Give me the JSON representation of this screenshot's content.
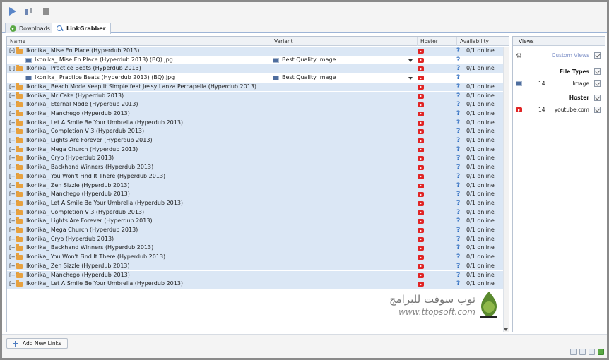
{
  "toolbar": {
    "start_icon": "play-icon",
    "pause_icon": "pause-icon",
    "stop_icon": "stop-icon"
  },
  "tabs": [
    {
      "label": "Downloads",
      "icon": "download-icon"
    },
    {
      "label": "LinkGrabber",
      "icon": "linkgrabber-icon"
    }
  ],
  "table": {
    "columns": {
      "name": "Name",
      "variant": "Variant",
      "hoster": "Hoster",
      "availability": "Availability"
    },
    "rows": [
      {
        "type": "package",
        "expander": "[-]",
        "name": "Ikonika_ Mise En Place (Hyperdub 2013)",
        "availability": "0/1 online"
      },
      {
        "type": "link",
        "name": "Ikonika_ Mise En Place (Hyperdub 2013) (BQ).jpg",
        "variant": "Best Quality Image",
        "availability": ""
      },
      {
        "type": "package",
        "expander": "[-]",
        "name": "Ikonika_ Practice Beats (Hyperdub 2013)",
        "availability": "0/1 online"
      },
      {
        "type": "link",
        "name": "Ikonika_ Practice Beats (Hyperdub 2013) (BQ).jpg",
        "variant": "Best Quality Image",
        "availability": ""
      },
      {
        "type": "package",
        "expander": "[+]",
        "name": "Ikonika_ Beach Mode Keep It Simple feat Jessy Lanza Percapella (Hyperdub 2013)",
        "availability": "0/1 online"
      },
      {
        "type": "package",
        "expander": "[+]",
        "name": "Ikonika_ Mr Cake (Hyperdub 2013)",
        "availability": "0/1 online"
      },
      {
        "type": "package",
        "expander": "[+]",
        "name": "Ikonika_ Eternal Mode (Hyperdub 2013)",
        "availability": "0/1 online"
      },
      {
        "type": "package",
        "expander": "[+]",
        "name": "Ikonika_ Manchego (Hyperdub 2013)",
        "availability": "0/1 online"
      },
      {
        "type": "package",
        "expander": "[+]",
        "name": "Ikonika_ Let A Smile Be Your Umbrella (Hyperdub 2013)",
        "availability": "0/1 online"
      },
      {
        "type": "package",
        "expander": "[+]",
        "name": "Ikonika_ Completion V 3 (Hyperdub 2013)",
        "availability": "0/1 online"
      },
      {
        "type": "package",
        "expander": "[+]",
        "name": "Ikonika_ Lights Are Forever (Hyperdub 2013)",
        "availability": "0/1 online"
      },
      {
        "type": "package",
        "expander": "[+]",
        "name": "Ikonika_ Mega Church (Hyperdub 2013)",
        "availability": "0/1 online"
      },
      {
        "type": "package",
        "expander": "[+]",
        "name": "Ikonika_ Cryo (Hyperdub 2013)",
        "availability": "0/1 online"
      },
      {
        "type": "package",
        "expander": "[+]",
        "name": "Ikonika_ Backhand Winners (Hyperdub 2013)",
        "availability": "0/1 online"
      },
      {
        "type": "package",
        "expander": "[+]",
        "name": "Ikonika_ You Won't Find It There (Hyperdub 2013)",
        "availability": "0/1 online"
      },
      {
        "type": "package",
        "expander": "[+]",
        "name": "Ikonika_ Zen Sizzle (Hyperdub 2013)",
        "availability": "0/1 online"
      },
      {
        "type": "package",
        "expander": "[+]",
        "name": "Ikonika_ Manchego (Hyperdub 2013)",
        "availability": "0/1 online"
      },
      {
        "type": "package",
        "expander": "[+]",
        "name": "Ikonika_ Let A Smile Be Your Umbrella (Hyperdub 2013)",
        "availability": "0/1 online"
      },
      {
        "type": "package",
        "expander": "[+]",
        "name": "Ikonika_ Completion V 3 (Hyperdub 2013)",
        "availability": "0/1 online"
      },
      {
        "type": "package",
        "expander": "[+]",
        "name": "Ikonika_ Lights Are Forever (Hyperdub 2013)",
        "availability": "0/1 online"
      },
      {
        "type": "package",
        "expander": "[+]",
        "name": "Ikonika_ Mega Church (Hyperdub 2013)",
        "availability": "0/1 online"
      },
      {
        "type": "package",
        "expander": "[+]",
        "name": "Ikonika_ Cryo (Hyperdub 2013)",
        "availability": "0/1 online"
      },
      {
        "type": "package",
        "expander": "[+]",
        "name": "Ikonika_ Backhand Winners (Hyperdub 2013)",
        "availability": "0/1 online"
      },
      {
        "type": "package",
        "expander": "[+]",
        "name": "Ikonika_ You Won't Find It There (Hyperdub 2013)",
        "availability": "0/1 online"
      },
      {
        "type": "package",
        "expander": "[+]",
        "name": "Ikonika_ Zen Sizzle (Hyperdub 2013)",
        "availability": "0/1 online"
      },
      {
        "type": "package",
        "expander": "[+]",
        "name": "Ikonika_ Manchego (Hyperdub 2013)",
        "availability": "0/1 online"
      },
      {
        "type": "package",
        "expander": "[+]",
        "name": "Ikonika_ Let A Smile Be Your Umbrella (Hyperdub 2013)",
        "availability": "0/1 online"
      }
    ]
  },
  "views_panel": {
    "title": "Views",
    "custom_views": "Custom Views",
    "file_types_title": "File Types",
    "file_types": [
      {
        "count": "14",
        "name": "Image"
      }
    ],
    "hoster_title": "Hoster",
    "hosters": [
      {
        "count": "14",
        "name": "youtube.com"
      }
    ]
  },
  "watermark": {
    "arabic": "توب سوفت للبرامج",
    "url": "www.ttopsoft.com"
  },
  "bottom": {
    "add_links_label": "Add New Links"
  },
  "colors": {
    "package_row_bg": "#dbe7f5",
    "youtube_red": "#e02424",
    "accent_blue": "#2d6cc0"
  }
}
